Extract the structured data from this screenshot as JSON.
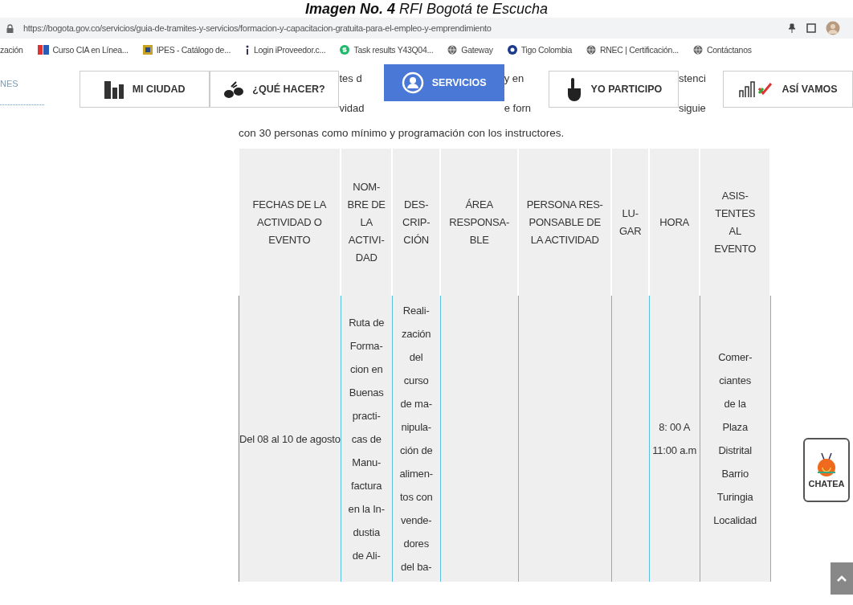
{
  "caption": "**Imagen No. 4** RFI Bogotá te Escucha",
  "browser": {
    "url": "https://bogota.gov.co/servicios/guia-de-tramites-y-servicios/formacion-y-capacitacion-gratuita-para-el-empleo-y-emprendimiento",
    "bookmarks": [
      {
        "label": "zación",
        "kind": "none"
      },
      {
        "label": "Curso CIA en Línea...",
        "kind": "logo"
      },
      {
        "label": "IPES - Catálogo de...",
        "kind": "emblem"
      },
      {
        "label": "Login iProveedor.c...",
        "kind": "info"
      },
      {
        "label": "Task results Y43Q04...",
        "kind": "green"
      },
      {
        "label": "Gateway",
        "kind": "globe"
      },
      {
        "label": "Tigo Colombia",
        "kind": "blue"
      },
      {
        "label": "RNEC | Certificación...",
        "kind": "globe"
      },
      {
        "label": "Contáctanos",
        "kind": "globe"
      }
    ]
  },
  "left_fragment": "NES",
  "nav": [
    {
      "kind": "button",
      "label": "MI CIUDAD",
      "selected": false
    },
    {
      "kind": "button",
      "label": "¿QUÉ HACER?",
      "selected": false
    },
    {
      "kind": "fragment",
      "lines": [
        "tes d",
        "vidad"
      ]
    },
    {
      "kind": "button",
      "label": "SERVICIOS",
      "selected": true
    },
    {
      "kind": "fragment",
      "lines": [
        "y en",
        "e forn"
      ]
    },
    {
      "kind": "button",
      "label": "YO PARTICIPO",
      "selected": false
    },
    {
      "kind": "fragment",
      "lines": [
        "stenci",
        "siguie"
      ]
    },
    {
      "kind": "button",
      "label": "ASÍ VAMOS",
      "selected": false
    }
  ],
  "paragraph": "con 30 personas como mínimo y programación con los instructores.",
  "table": {
    "columns": [
      "FECHAS DE LA\nACTIVIDAD O\nEVENTO",
      "NOM-\nBRE DE\nLA\nACTIVI-\nDAD",
      "DES-\nCRIP-\nCIÓN",
      "ÁREA\nRESPONSA-\nBLE",
      "PERSONA RES-\nPONSABLE DE\nLA ACTIVIDAD",
      "LU-\nGAR",
      "HORA",
      "ASIS-\nTENTES\nAL\nEVENTO"
    ],
    "rows": [
      [
        "Del 08 al 10 de agosto",
        "Ruta de\nForma-\ncion en\nBuenas\npracti-\ncas de\nManu-\nfactura\nen la In-\ndustia\nde Ali-",
        "Reali-\nzación\ndel\ncurso\nde ma-\nnipula-\nción de\nalimen-\ntos con\nvende-\ndores\ndel ba-",
        "",
        "",
        "",
        "8: 00 A\n11:00 a.m",
        "Comer-\nciantes\nde la\nPlaza\nDistrital\nBarrio\nTuringia\nLocalidad"
      ]
    ]
  },
  "chat_widget": {
    "label": "CHATEA"
  }
}
